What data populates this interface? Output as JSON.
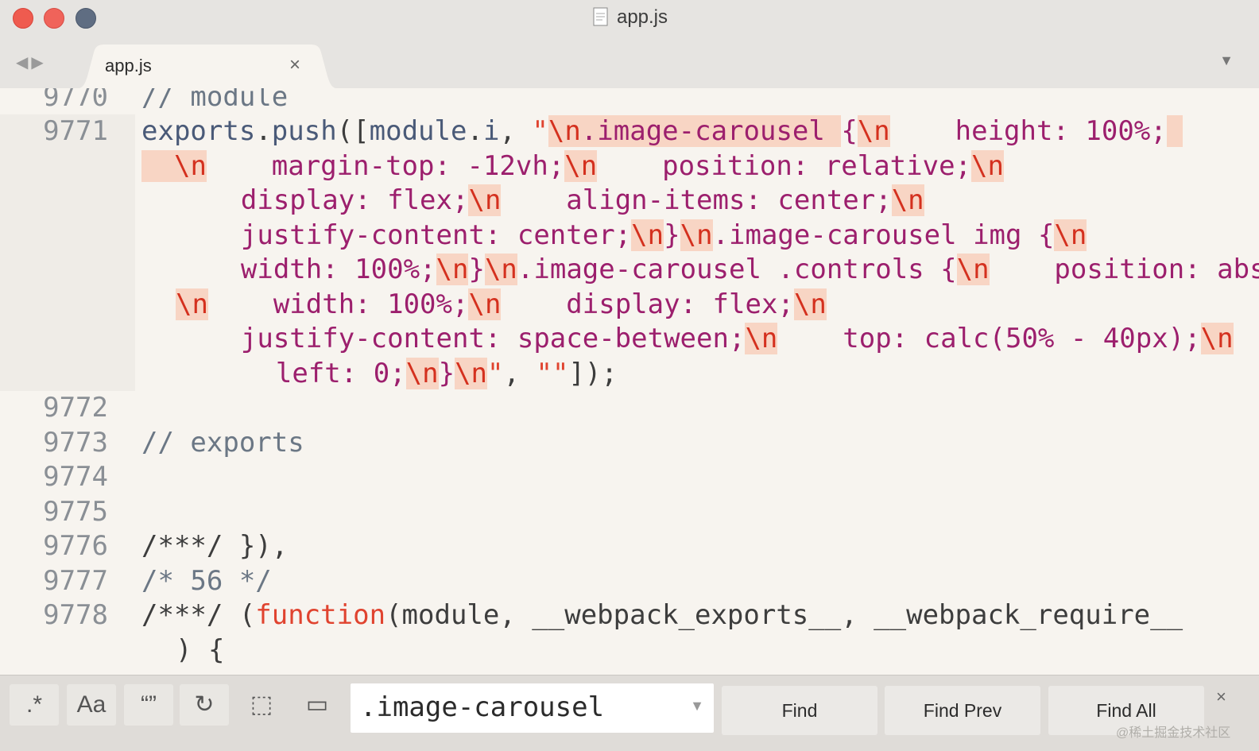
{
  "window": {
    "title": "app.js"
  },
  "tabs": [
    {
      "label": "app.js",
      "close": "×"
    }
  ],
  "editor": {
    "lines": [
      {
        "number": "9770",
        "text": "// module"
      },
      {
        "number": "9771",
        "segments": [
          "exports",
          ".",
          "push",
          "([",
          "module",
          ".",
          "i",
          ", ",
          "\"",
          "\\n",
          ".image-carousel ",
          "{",
          "\\n",
          "    height: 100%;",
          "\\n",
          "    margin-top: -12vh;",
          "\\n",
          "    position: relative;",
          "\\n",
          "    display: flex;",
          "\\n",
          "    align-items: center;",
          "\\n",
          "    justify-content: center;",
          "\\n",
          "}",
          "\\n",
          ".image-carousel img {",
          "\\n",
          "    width: 100%;",
          "\\n",
          "}",
          "\\n",
          ".image-carousel .controls {",
          "\\n",
          "    position: absolute;",
          "\\n",
          "    width: 100%;",
          "\\n",
          "    display: flex;",
          "\\n",
          "    justify-content: space-between;",
          "\\n",
          "    top: calc(50% - 40px);",
          "\\n",
          "    left: 0;",
          "\\n",
          "}",
          "\\n",
          "\"",
          ", ",
          "\"\"",
          "]);"
        ]
      },
      {
        "number": "9772",
        "text": ""
      },
      {
        "number": "9773",
        "text": "// exports"
      },
      {
        "number": "9774",
        "text": ""
      },
      {
        "number": "9775",
        "text": ""
      },
      {
        "number": "9776",
        "text": "/***/ }),"
      },
      {
        "number": "9777",
        "text": "/* 56 */"
      },
      {
        "number": "9778",
        "segments": [
          "/***/ (",
          "function",
          "(module, __webpack_exports__, __webpack_require__",
          ") {"
        ]
      }
    ]
  },
  "find_panel": {
    "toggles": [
      {
        "name": "regex",
        "label": ".*"
      },
      {
        "name": "case-sensitive",
        "label": "Aa"
      },
      {
        "name": "whole-word",
        "label": "“”"
      },
      {
        "name": "wrap",
        "label": "↻"
      },
      {
        "name": "in-selection",
        "label": "⬚"
      },
      {
        "name": "highlight-matches",
        "label": "▭"
      }
    ],
    "query": ".image-carousel",
    "buttons": {
      "find": "Find",
      "find_prev": "Find Prev",
      "find_all": "Find All"
    },
    "close": "×"
  },
  "watermark": "@稀土掘金技术社区",
  "colors": {
    "keyword": "#9c1f6d",
    "escape_bg": "#f8d5c4",
    "escape": "#d4301e",
    "comment": "#6b7785",
    "background": "#f7f4ef"
  }
}
